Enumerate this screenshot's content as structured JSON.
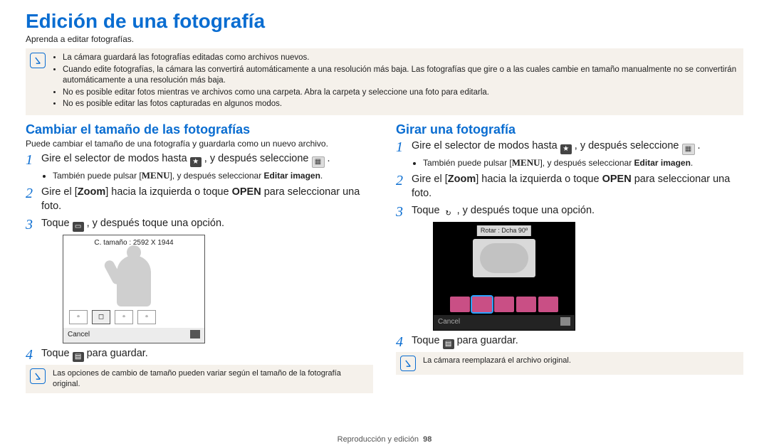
{
  "title": "Edición de una fotografía",
  "subtitle": "Aprenda a editar fotografías.",
  "top_notes": [
    "La cámara guardará las fotografías editadas como archivos nuevos.",
    "Cuando edite fotografías, la cámara las convertirá automáticamente a una resolución más baja. Las fotografías que gire o a las cuales cambie en tamaño manualmente no se convertirán automáticamente a una resolución más baja.",
    "No es posible editar fotos mientras ve archivos como una carpeta. Abra la carpeta y seleccione una foto para editarla.",
    "No es posible editar las fotos capturadas en algunos modos."
  ],
  "left": {
    "heading": "Cambiar el tamaño de las fotografías",
    "lead": "Puede cambiar el tamaño de una fotografía y guardarla como un nuevo archivo.",
    "step1a": "Gire el selector de modos hasta ",
    "step1b": " , y después seleccione ",
    "step1c": " .",
    "sub1a": "También puede pulsar [",
    "sub1b": "], y después seleccionar ",
    "sub1c": "Editar imagen",
    "sub1d": ".",
    "menu_label": "MENU",
    "step2a": "Gire el [",
    "step2b": "Zoom",
    "step2c": "] hacia la izquierda o toque ",
    "step2d": "OPEN",
    "step2e": " para seleccionar una foto.",
    "step3a": "Toque ",
    "step3b": " , y después toque una opción.",
    "shot_header": "C. tamaño : 2592 X 1944",
    "shot_cancel": "Cancel",
    "step4a": "Toque ",
    "step4b": " para guardar.",
    "bottom_note": "Las opciones de cambio de tamaño pueden variar según el tamaño de la fotografía original."
  },
  "right": {
    "heading": "Girar una fotografía",
    "step1a": "Gire el selector de modos hasta ",
    "step1b": " , y después seleccione ",
    "step1c": " .",
    "sub1a": "También puede pulsar [",
    "sub1b": "], y después seleccionar ",
    "sub1c": "Editar imagen",
    "sub1d": ".",
    "menu_label": "MENU",
    "step2a": "Gire el [",
    "step2b": "Zoom",
    "step2c": "] hacia la izquierda o toque ",
    "step2d": "OPEN",
    "step2e": " para seleccionar una foto.",
    "step3a": "Toque ",
    "step3b": " , y después toque una opción.",
    "shot_header": "Rotar : Dcha 90º",
    "shot_cancel": "Cancel",
    "step4a": "Toque ",
    "step4b": " para guardar.",
    "bottom_note": "La cámara reemplazará el archivo original."
  },
  "footer": "Reproducción y edición",
  "page_number": "98"
}
